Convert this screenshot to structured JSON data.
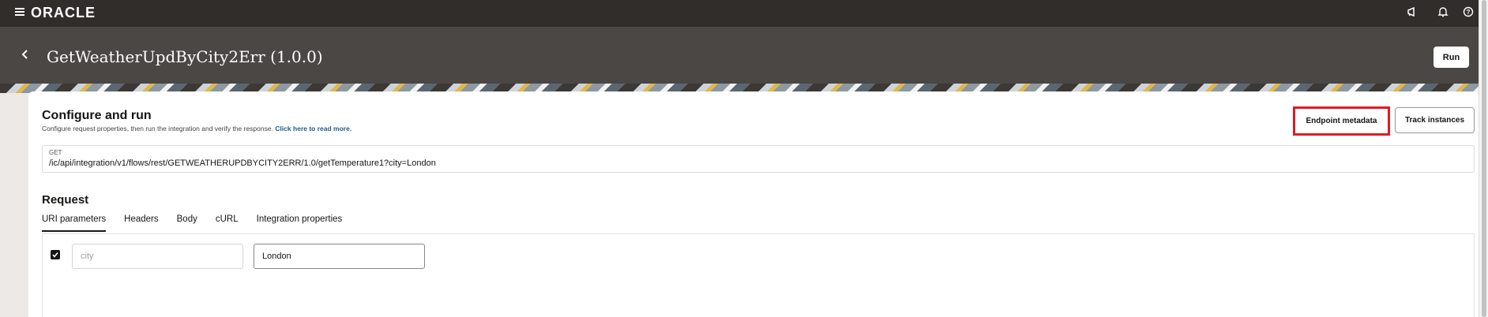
{
  "topbar": {
    "logo": "ORACLE",
    "icons": [
      "menu-icon",
      "announcement-icon",
      "bell-icon",
      "help-icon"
    ]
  },
  "header": {
    "title": "GetWeatherUpdByCity2Err (1.0.0)",
    "run_label": "Run"
  },
  "configure": {
    "title": "Configure and run",
    "description": "Configure request properties, then run the integration and verify the response.",
    "link": "Click here to read more.",
    "endpoint_metadata_label": "Endpoint metadata",
    "track_instances_label": "Track instances"
  },
  "endpoint": {
    "method": "GET",
    "path": "/ic/api/integration/v1/flows/rest/GETWEATHERUPDBYCITY2ERR/1.0/getTemperature1?city=London"
  },
  "request": {
    "title": "Request",
    "tabs": [
      {
        "label": "URI parameters",
        "active": true
      },
      {
        "label": "Headers",
        "active": false
      },
      {
        "label": "Body",
        "active": false
      },
      {
        "label": "cURL",
        "active": false
      },
      {
        "label": "Integration properties",
        "active": false
      }
    ],
    "params": [
      {
        "checked": true,
        "name_placeholder": "city",
        "value": "London"
      }
    ]
  },
  "colors": {
    "topbar": "#312d2a",
    "header": "#4a4744",
    "highlight": "#e11b22",
    "link": "#1f5a93"
  }
}
